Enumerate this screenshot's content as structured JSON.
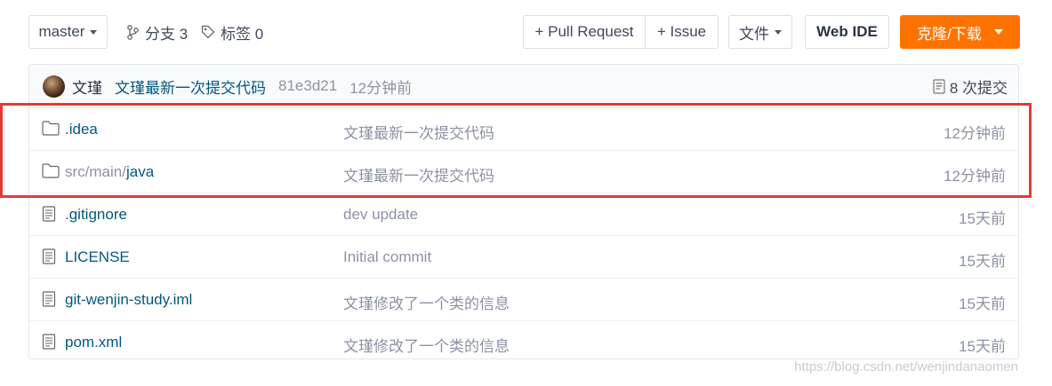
{
  "toolbar": {
    "branch": "master",
    "branches": "分支 3",
    "tags": "标签 0",
    "pull_request": "+ Pull Request",
    "issue": "+ Issue",
    "files": "文件",
    "web_ide": "Web IDE",
    "clone": "克隆/下载"
  },
  "commit": {
    "author": "文瑾",
    "message": "文瑾最新一次提交代码",
    "hash": "81e3d21",
    "time": "12分钟前",
    "count": "8 次提交"
  },
  "files": [
    {
      "name_dim": "",
      "name": ".idea",
      "type": "folder",
      "message": "文瑾最新一次提交代码",
      "time": "12分钟前"
    },
    {
      "name_dim": "src/main/",
      "name": "java",
      "type": "folder",
      "message": "文瑾最新一次提交代码",
      "time": "12分钟前"
    },
    {
      "name_dim": "",
      "name": ".gitignore",
      "type": "file",
      "message": "dev update",
      "time": "15天前"
    },
    {
      "name_dim": "",
      "name": "LICENSE",
      "type": "file",
      "message": "Initial commit",
      "time": "15天前"
    },
    {
      "name_dim": "",
      "name": "git-wenjin-study.iml",
      "type": "file",
      "message": "文瑾修改了一个类的信息",
      "time": "15天前"
    },
    {
      "name_dim": "",
      "name": "pom.xml",
      "type": "file",
      "message": "文瑾修改了一个类的信息",
      "time": "15天前"
    }
  ],
  "watermark": "https://blog.csdn.net/wenjindanaomen",
  "colors": {
    "accent": "#fe7300",
    "link": "#005980",
    "highlight": "#e53935"
  }
}
